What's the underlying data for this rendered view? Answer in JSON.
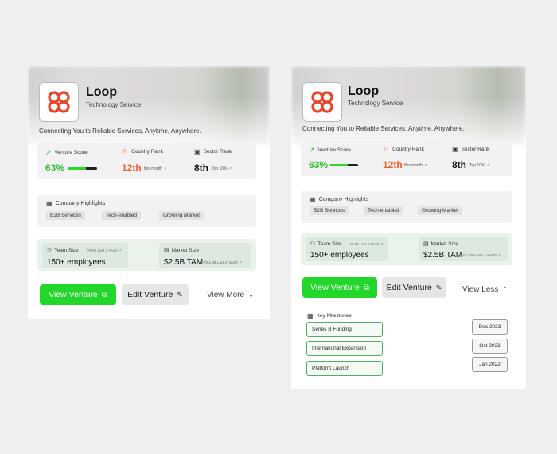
{
  "venture": {
    "name": "Loop",
    "category": "Technology Service",
    "tagline": "Connecting You to Reliable Services, Anytime, Anywhere."
  },
  "stats": {
    "venture_score": {
      "label": "Venture Score",
      "value": "63%",
      "progress": 0.63
    },
    "country_rank": {
      "label": "Country Rank",
      "value": "12th",
      "note": "this month"
    },
    "sector_rank": {
      "label": "Sector Rank",
      "value": "8th",
      "note": "Top 10%"
    }
  },
  "highlights": {
    "title": "Company Highlights",
    "chips": [
      "B2B Services",
      "Tech-enabled",
      "Growing Market"
    ]
  },
  "metrics": {
    "team": {
      "label": "Team Size",
      "note": "VS 55 Last 3 Years",
      "value": "150+ employees"
    },
    "market": {
      "label": "Market Size",
      "note": "VS 1.9B Last 3 month",
      "value": "$2.5B TAM"
    }
  },
  "actions": {
    "view_venture": "View Venture",
    "edit_venture": "Edit Venture",
    "view_more": "View More",
    "view_less": "View Less"
  },
  "milestones": {
    "title": "Key Milestones",
    "items": [
      {
        "name": "Series B Funding",
        "date": "Dec 2023"
      },
      {
        "name": "International Expansion",
        "date": "Oct 2023"
      },
      {
        "name": "Platform Launch",
        "date": "Jan 2022"
      }
    ]
  },
  "colors": {
    "accent": "#22d62a",
    "rank": "#e8622a",
    "logo": "#e8452a"
  }
}
